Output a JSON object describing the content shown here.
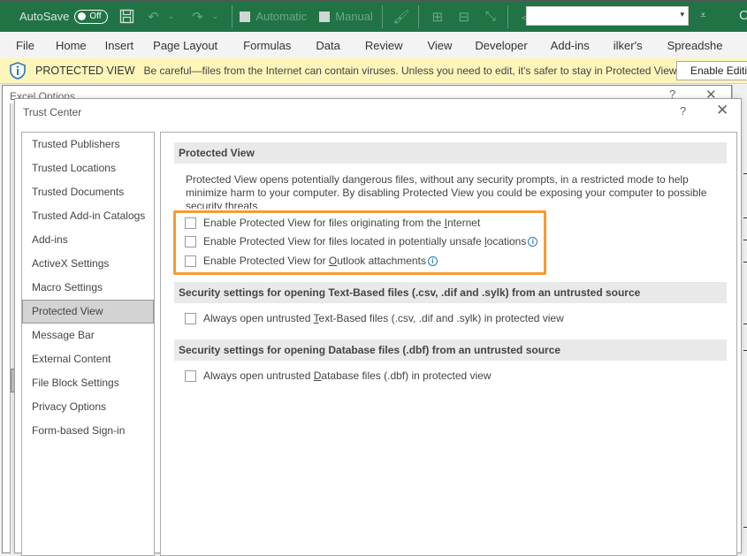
{
  "qat": {
    "autosave_label": "AutoSave",
    "autosave_state": "Off",
    "icons": [
      "save-icon",
      "undo-icon",
      "redo-icon"
    ],
    "calc_options": [
      {
        "label": "Automatic",
        "checked": false
      },
      {
        "label": "Manual",
        "checked": false
      }
    ],
    "tools_icons": [
      "format-painter-icon",
      "trace-precedents-icon",
      "trace-dependents-icon",
      "remove-arrows-icon",
      "group-icon",
      "ungroup-icon"
    ],
    "combo_value": "",
    "more_glyph": "⩡",
    "tail_glyph": "C"
  },
  "ribbon": {
    "tabs": [
      "File",
      "Home",
      "Insert",
      "Page Layout",
      "Formulas",
      "Data",
      "Review",
      "View",
      "Developer",
      "Add-ins",
      "ilker's",
      "Spreadshe"
    ]
  },
  "protected_bar": {
    "title": "PROTECTED VIEW",
    "message": "Be careful—files from the Internet can contain viruses. Unless you need to edit, it's safer to stay in Protected View.",
    "button": "Enable Editing"
  },
  "background_dialog": {
    "title": "Excel Options",
    "help": "?",
    "close": "✕"
  },
  "trust_center": {
    "title": "Trust Center",
    "help": "?",
    "close": "✕",
    "nav": [
      {
        "label": "Trusted Publishers",
        "active": false
      },
      {
        "label": "Trusted Locations",
        "active": false
      },
      {
        "label": "Trusted Documents",
        "active": false
      },
      {
        "label": "Trusted Add-in Catalogs",
        "active": false
      },
      {
        "label": "Add-ins",
        "active": false
      },
      {
        "label": "ActiveX Settings",
        "active": false
      },
      {
        "label": "Macro Settings",
        "active": false
      },
      {
        "label": "Protected View",
        "active": true
      },
      {
        "label": "Message Bar",
        "active": false
      },
      {
        "label": "External Content",
        "active": false
      },
      {
        "label": "File Block Settings",
        "active": false
      },
      {
        "label": "Privacy Options",
        "active": false
      },
      {
        "label": "Form-based Sign-in",
        "active": false
      }
    ],
    "protected_view": {
      "heading": "Protected View",
      "description": "Protected View opens potentially dangerous files, without any security prompts, in a restricted mode to help minimize harm to your computer. By disabling Protected View you could be exposing your computer to possible security threats.",
      "options": [
        {
          "pre": "Enable Protected View for files originating from the ",
          "key": "I",
          "post": "nternet",
          "checked": false,
          "info": false
        },
        {
          "pre": "Enable Protected View for files located in potentially unsafe ",
          "key": "l",
          "post": "ocations",
          "checked": false,
          "info": true
        },
        {
          "pre": "Enable Protected View for ",
          "key": "O",
          "post": "utlook attachments",
          "checked": false,
          "info": true
        }
      ]
    },
    "text_based": {
      "heading": "Security settings for opening Text-Based files (.csv, .dif and .sylk) from an untrusted source",
      "option": {
        "pre": "Always open untrusted ",
        "key": "T",
        "post": "ext-Based files (.csv, .dif and .sylk) in protected view",
        "checked": false
      }
    },
    "database": {
      "heading": "Security settings for opening Database files (.dbf) from an untrusted source",
      "option": {
        "pre": "Always open untrusted ",
        "key": "D",
        "post": "atabase files (.dbf) in protected view",
        "checked": false
      }
    },
    "info_glyph": "i"
  },
  "colors": {
    "excel_green": "#217346",
    "protected_bar": "#fdf5ba",
    "highlight_orange": "#f79a35",
    "info_blue": "#2a7ab5"
  }
}
